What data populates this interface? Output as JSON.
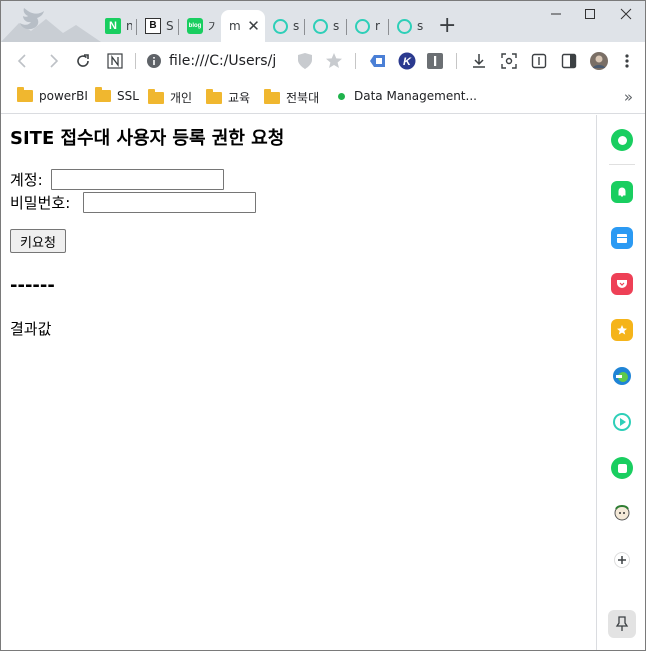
{
  "tabs": [
    {
      "label": "n",
      "icon": "naver-icon"
    },
    {
      "label": "S",
      "icon": "blogger-b-icon"
    },
    {
      "label": "기",
      "icon": "naver-blog-icon"
    },
    {
      "label": "m",
      "icon": "document-icon",
      "active": true
    },
    {
      "label": "s",
      "icon": "whale-ring-icon"
    },
    {
      "label": "s",
      "icon": "whale-ring-icon"
    },
    {
      "label": "r",
      "icon": "whale-ring-icon"
    },
    {
      "label": "s",
      "icon": "whale-ring-icon"
    }
  ],
  "favicon_texts": {
    "naver": "N",
    "blogger": "B",
    "blog": "blog"
  },
  "address": {
    "url": "file:///C:/Users/jh"
  },
  "bookmarks": [
    {
      "label": "powerBI",
      "icon": "folder-icon"
    },
    {
      "label": "SSL",
      "icon": "folder-icon"
    },
    {
      "label": "개인",
      "icon": "folder-icon"
    },
    {
      "label": "교육",
      "icon": "folder-icon"
    },
    {
      "label": "전북대",
      "icon": "folder-icon"
    },
    {
      "label": "Data Management...",
      "icon": "green-dot-icon"
    }
  ],
  "page": {
    "title": "SITE 접수대 사용자 등록 권한 요청",
    "account_label": "계정:",
    "password_label": "비밀번호:",
    "account_value": "",
    "password_value": "",
    "request_button": "키요청",
    "divider": "------",
    "result": "결과값"
  },
  "colors": {
    "tabstrip_bg": "#dfe3e8",
    "folder": "#f0b72f",
    "whale_teal": "#2ecfb8",
    "naver_green": "#19ce60"
  },
  "side_panel": [
    "green-circle-icon",
    "bell-icon",
    "calendar-icon",
    "pocket-icon",
    "star-icon",
    "edge-icon",
    "play-icon",
    "green-square-icon",
    "avatar-icon",
    "plus-icon",
    "pin-icon"
  ]
}
